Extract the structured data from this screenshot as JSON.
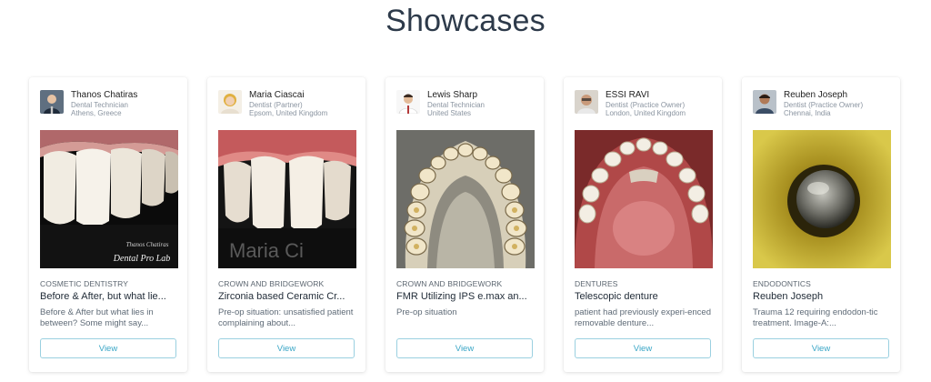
{
  "page": {
    "title": "Showcases"
  },
  "cards": [
    {
      "author_name": "Thanos Chatiras",
      "author_role": "Dental Technician",
      "author_location": "Athens, Greece",
      "image_caption_1": "Thanos Chatiras",
      "image_caption_2": "Dental Pro Lab",
      "category": "COSMETIC DENTISTRY",
      "title": "Before & After, but what lie...",
      "description": "Before & After but what lies in between? Some might say...",
      "button": "View"
    },
    {
      "author_name": "Maria Ciascai",
      "author_role": "Dentist (Partner)",
      "author_location": "Epsom, United Kingdom",
      "image_caption_1": "Maria Ci",
      "category": "CROWN AND BRIDGEWORK",
      "title": "Zirconia based Ceramic Cr...",
      "description": "Pre-op situation: unsatisfied patient complaining about...",
      "button": "View"
    },
    {
      "author_name": "Lewis Sharp",
      "author_role": "Dental Technician",
      "author_location": "United States",
      "category": "CROWN AND BRIDGEWORK",
      "title": "FMR Utilizing IPS e.max an...",
      "description": "Pre-op situation",
      "button": "View"
    },
    {
      "author_name": "ESSI RAVI",
      "author_role": "Dentist (Practice Owner)",
      "author_location": "London, United Kingdom",
      "category": "DENTURES",
      "title": "Telescopic denture",
      "description": "patient had previously experi-enced removable denture...",
      "button": "View"
    },
    {
      "author_name": "Reuben Joseph",
      "author_role": "Dentist (Practice Owner)",
      "author_location": "Chennai, India",
      "category": "ENDODONTICS",
      "title": "Reuben Joseph",
      "description": "Trauma 12 requiring endodon-tic treatment. Image-A:...",
      "button": "View"
    }
  ]
}
